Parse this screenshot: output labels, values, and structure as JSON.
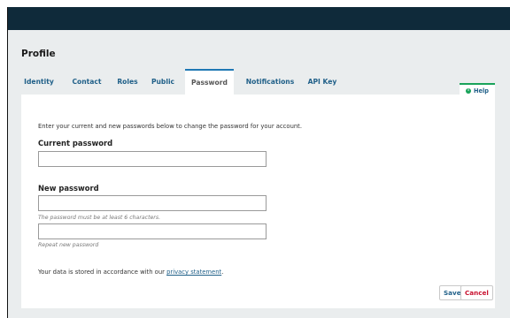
{
  "page": {
    "title": "Profile"
  },
  "tabs": [
    {
      "label": "Identity",
      "active": false
    },
    {
      "label": "Contact",
      "active": false
    },
    {
      "label": "Roles",
      "active": false
    },
    {
      "label": "Public",
      "active": false
    },
    {
      "label": "Password",
      "active": true
    },
    {
      "label": "Notifications",
      "active": false
    },
    {
      "label": "API Key",
      "active": false
    }
  ],
  "help": {
    "label": "Help",
    "icon": "info-icon"
  },
  "form": {
    "intro": "Enter your current and new passwords below to change the password for your account.",
    "current_password_label": "Current password",
    "current_password_value": "",
    "new_password_label": "New password",
    "new_password_value": "",
    "new_password_hint": "The password must be at least 6 characters.",
    "repeat_password_value": "",
    "repeat_password_hint": "Repeat new password",
    "privacy_prefix": "Your data is stored in accordance with our ",
    "privacy_link": "privacy statement",
    "privacy_suffix": "."
  },
  "actions": {
    "save": "Save",
    "cancel": "Cancel"
  },
  "colors": {
    "topbar": "#0f2a3a",
    "link": "#1f5f88",
    "active_tab_border": "#1f78b4",
    "help_accent": "#19a35a",
    "cancel": "#c8102e"
  }
}
